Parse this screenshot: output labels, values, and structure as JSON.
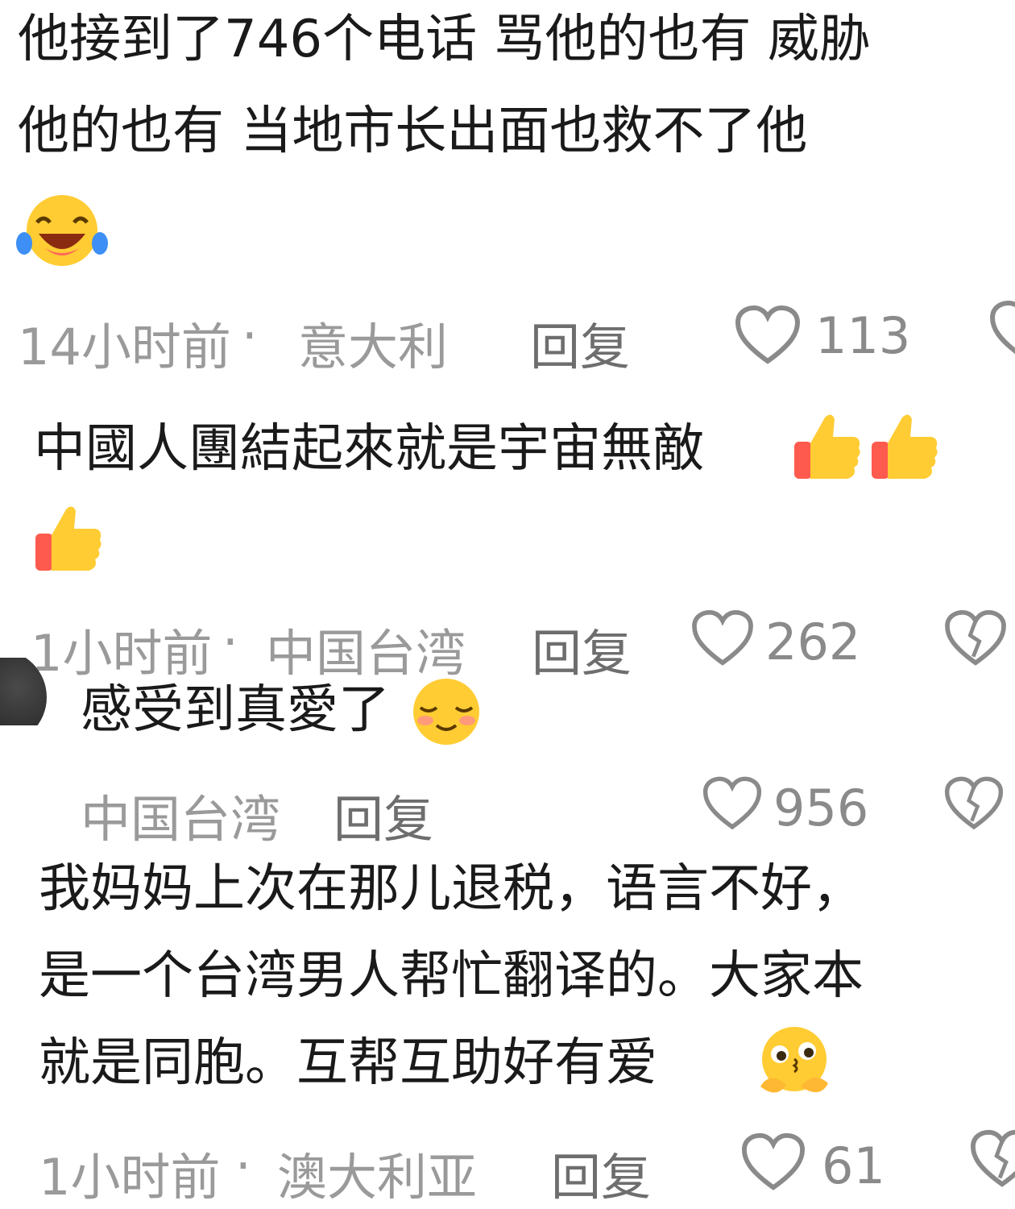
{
  "comments": [
    {
      "text_line1": "他接到了746个电话 骂他的也有 威胁",
      "text_line2": "他的也有 当地市长出面也救不了他",
      "emoji": "laughing-tears-emoji",
      "time": "14小时前",
      "sep": "·",
      "location": "意大利",
      "reply": "回复",
      "likes": "113"
    },
    {
      "text_line1": "中國人團結起來就是宇宙無敵",
      "emoji": "thumbs-up-emoji",
      "time": "1小时前",
      "sep": "·",
      "location": "中国台湾",
      "reply": "回复",
      "likes": "262"
    },
    {
      "text_line1": "感受到真愛了",
      "emoji": "blushing-smile-emoji",
      "location": "中国台湾",
      "reply": "回复",
      "likes": "956"
    },
    {
      "text_line1": "我妈妈上次在那儿退税，语言不好，",
      "text_line2": "是一个台湾男人帮忙翻译的。大家本",
      "text_line3": "就是同胞。互帮互助好有爱",
      "emoji": "pleading-hands-emoji",
      "time": "1小时前",
      "sep": "·",
      "location": "澳大利亚",
      "reply": "回复",
      "likes": "61"
    }
  ],
  "colors": {
    "meta": "#9a9a9a",
    "text": "#1a1a1a",
    "emoji_yellow": "#ffcc33",
    "emoji_red": "#ff5a4e"
  }
}
